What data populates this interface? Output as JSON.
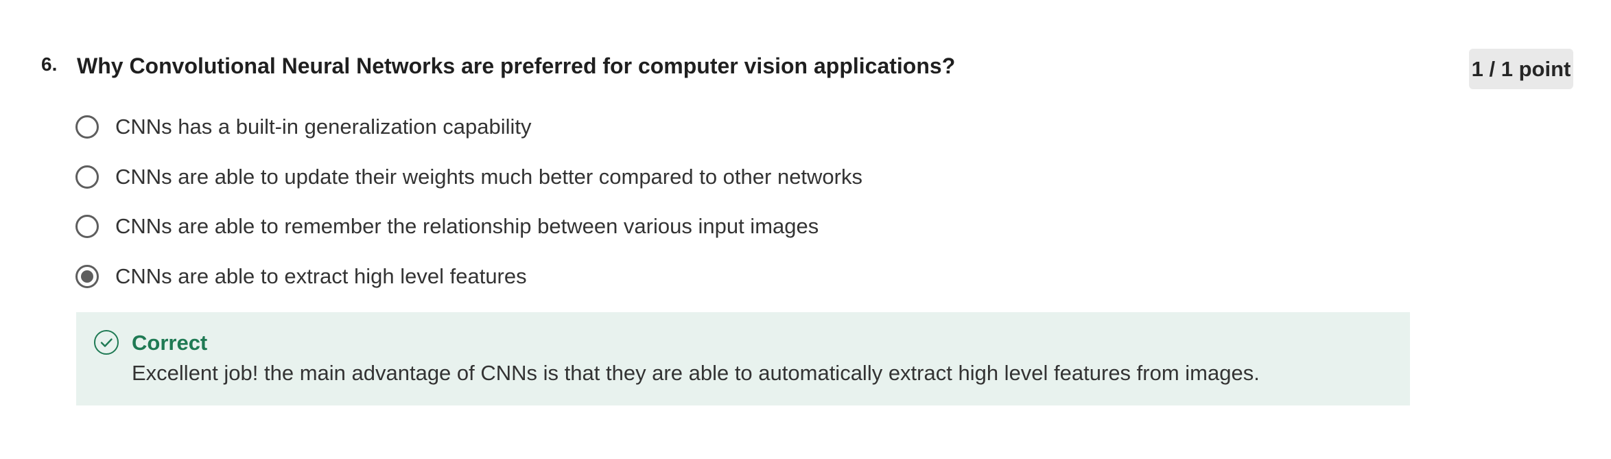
{
  "question": {
    "number": "6.",
    "text": "Why Convolutional Neural Networks are preferred for computer vision applications?",
    "points": "1 / 1 point"
  },
  "options": [
    {
      "label": "CNNs has a built-in generalization capability",
      "selected": false
    },
    {
      "label": "CNNs are able to update their weights much better compared to other networks",
      "selected": false
    },
    {
      "label": "CNNs are able to remember the relationship between various input images",
      "selected": false
    },
    {
      "label": "CNNs are able to extract high level features",
      "selected": true
    }
  ],
  "feedback": {
    "icon": "check-circle-icon",
    "title": "Correct",
    "text": "Excellent job! the main advantage of CNNs is that they are able to automatically extract high level features from images."
  },
  "colors": {
    "feedback_background": "#e8f2ee",
    "feedback_accent": "#1f7a54",
    "points_badge_background": "#e9e9e9",
    "radio_border": "#5e5e5e"
  }
}
